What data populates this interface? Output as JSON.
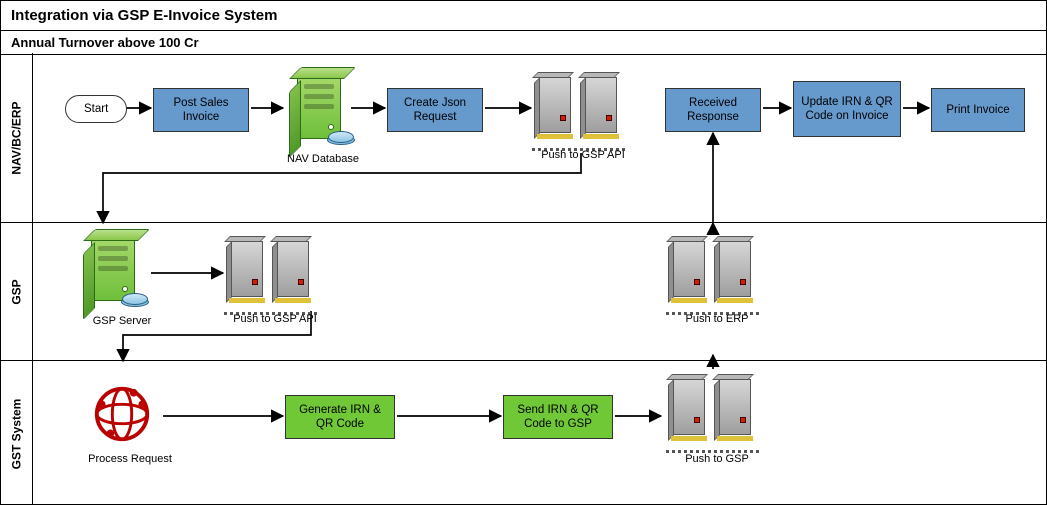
{
  "title": "Integration via GSP E-Invoice System",
  "subtitle": "Annual Turnover above 100 Cr",
  "lanes": {
    "lane1": "NAV/BC/ERP",
    "lane2": "GSP",
    "lane3": "GST System"
  },
  "nodes": {
    "start": "Start",
    "post_sales": "Post Sales Invoice",
    "nav_db_caption": "NAV Database",
    "create_json": "Create Json Request",
    "push_gsp_api_1": "Push to GSP API",
    "received_response": "Received Response",
    "update_irn": "Update IRN & QR Code on Invoice",
    "print_invoice": "Print Invoice",
    "gsp_server_caption": "GSP Server",
    "push_gsp_api_2": "Push to GSP API",
    "push_to_erp": "Push to ERP",
    "process_request_caption": "Process Request",
    "gen_irn": "Generate IRN & QR Code",
    "send_irn": "Send IRN & QR Code to GSP",
    "push_to_gsp": "Push to GSP"
  },
  "chart_data": {
    "type": "flow",
    "title": "Integration via GSP E-Invoice System",
    "subtitle": "Annual Turnover above 100 Cr",
    "swimlanes": [
      "NAV/BC/ERP",
      "GSP",
      "GST System"
    ],
    "nodes": [
      {
        "id": "start",
        "lane": "NAV/BC/ERP",
        "label": "Start",
        "shape": "terminator"
      },
      {
        "id": "post_sales",
        "lane": "NAV/BC/ERP",
        "label": "Post Sales Invoice",
        "shape": "process-blue"
      },
      {
        "id": "nav_db",
        "lane": "NAV/BC/ERP",
        "label": "NAV Database",
        "shape": "server-db-icon"
      },
      {
        "id": "create_json",
        "lane": "NAV/BC/ERP",
        "label": "Create Json Request",
        "shape": "process-blue"
      },
      {
        "id": "racks_nav",
        "lane": "NAV/BC/ERP",
        "label": "Push to GSP API",
        "shape": "servers-icon"
      },
      {
        "id": "received_response",
        "lane": "NAV/BC/ERP",
        "label": "Received Response",
        "shape": "process-blue"
      },
      {
        "id": "update_irn",
        "lane": "NAV/BC/ERP",
        "label": "Update IRN & QR Code on Invoice",
        "shape": "process-blue"
      },
      {
        "id": "print_invoice",
        "lane": "NAV/BC/ERP",
        "label": "Print Invoice",
        "shape": "process-blue"
      },
      {
        "id": "gsp_server",
        "lane": "GSP",
        "label": "GSP Server",
        "shape": "server-db-icon"
      },
      {
        "id": "racks_gsp_left",
        "lane": "GSP",
        "label": "Push to GSP API",
        "shape": "servers-icon"
      },
      {
        "id": "racks_gsp_right",
        "lane": "GSP",
        "label": "Push to ERP",
        "shape": "servers-icon"
      },
      {
        "id": "process_request",
        "lane": "GST System",
        "label": "Process Request",
        "shape": "network-icon"
      },
      {
        "id": "gen_irn",
        "lane": "GST System",
        "label": "Generate IRN & QR Code",
        "shape": "process-green"
      },
      {
        "id": "send_irn",
        "lane": "GST System",
        "label": "Send IRN & QR Code to GSP",
        "shape": "process-green"
      },
      {
        "id": "racks_gst",
        "lane": "GST System",
        "label": "Push to GSP",
        "shape": "servers-icon"
      }
    ],
    "edges": [
      [
        "start",
        "post_sales"
      ],
      [
        "post_sales",
        "nav_db"
      ],
      [
        "nav_db",
        "create_json"
      ],
      [
        "create_json",
        "racks_nav"
      ],
      [
        "racks_nav",
        "gsp_server"
      ],
      [
        "gsp_server",
        "racks_gsp_left"
      ],
      [
        "racks_gsp_left",
        "process_request"
      ],
      [
        "process_request",
        "gen_irn"
      ],
      [
        "gen_irn",
        "send_irn"
      ],
      [
        "send_irn",
        "racks_gst"
      ],
      [
        "racks_gst",
        "racks_gsp_right"
      ],
      [
        "racks_gsp_right",
        "received_response"
      ],
      [
        "received_response",
        "update_irn"
      ],
      [
        "update_irn",
        "print_invoice"
      ]
    ]
  }
}
